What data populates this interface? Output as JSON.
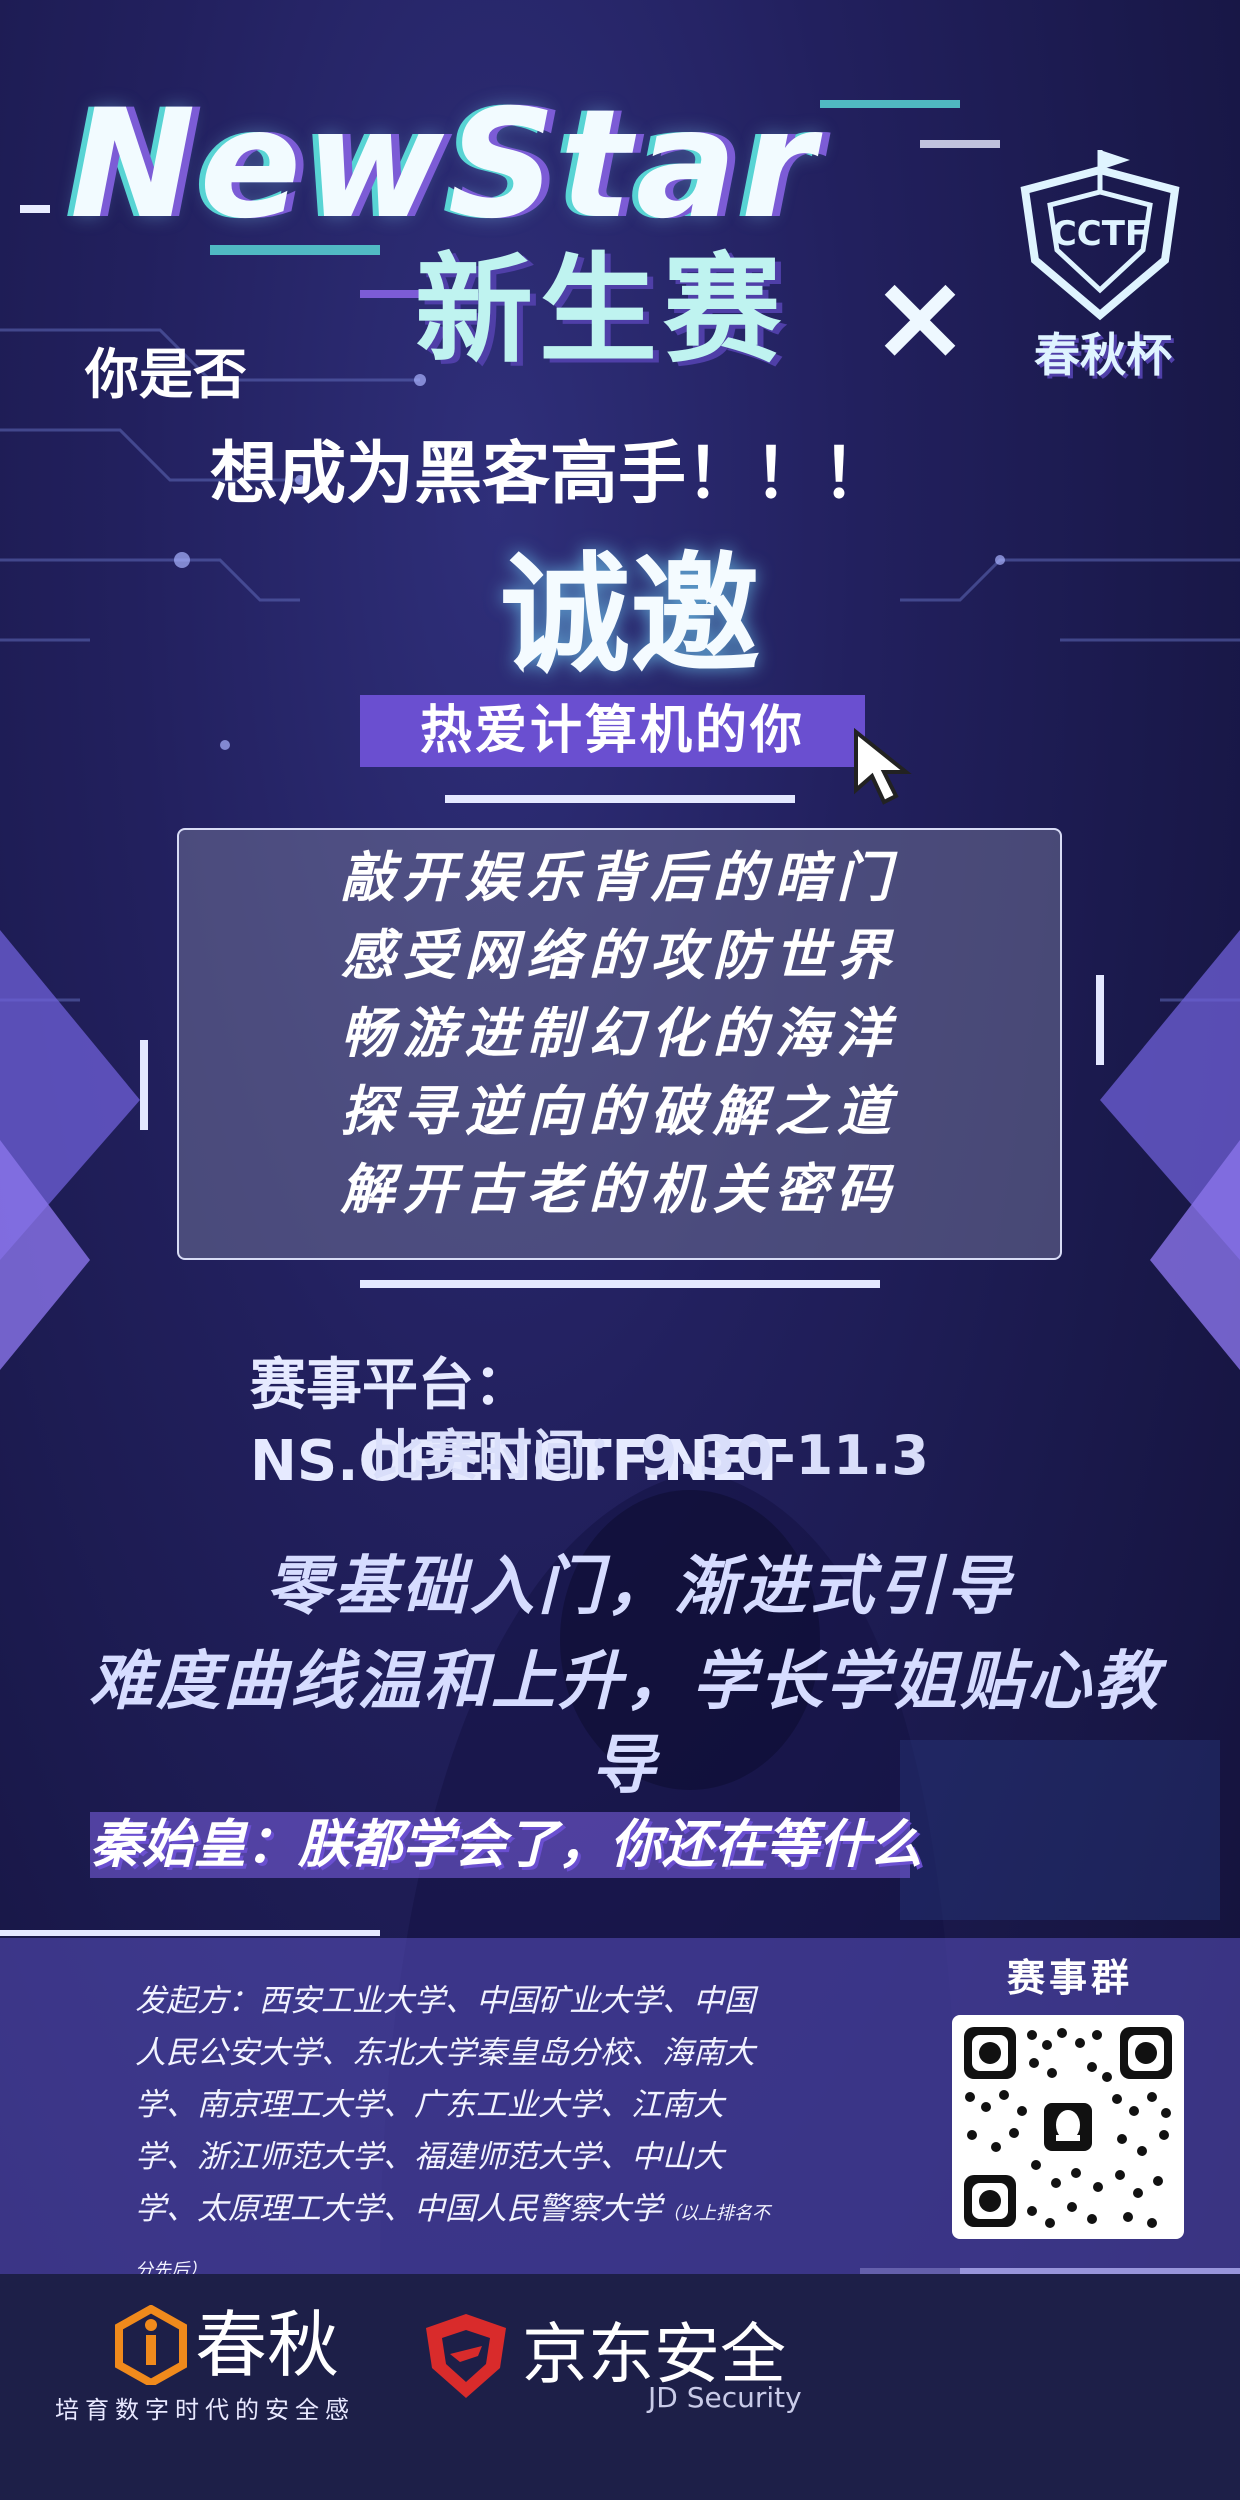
{
  "header": {
    "title": "NewStar",
    "subtitle": "新生赛",
    "times_symbol": "×",
    "partner_badge": "CCTF",
    "partner_label": "春秋杯"
  },
  "hero": {
    "question_line1": "你是否",
    "question_line2": "想成为黑客高手！！！",
    "invite": "诚邀",
    "invite_target": "热爱计算机的你"
  },
  "features": [
    "敲开娱乐背后的暗门",
    "感受网络的攻防世界",
    "畅游进制幻化的海洋",
    "探寻逆向的破解之道",
    "解开古老的机关密码"
  ],
  "event_info": {
    "platform": "赛事平台：NS.OPENCTF.NET",
    "time": "比赛时间：9.30-11.3"
  },
  "slogans": {
    "line1": "零基础入门，渐进式引导",
    "line2": "难度曲线温和上升，学长学姐贴心教导"
  },
  "quote": "秦始皇：朕都学会了，你还在等什么",
  "sponsors": {
    "text": "发起方：西安工业大学、中国矿业大学、中国人民公安大学、东北大学秦皇岛分校、海南大学、南京理工大学、广东工业大学、江南大学、浙江师范大学、福建师范大学、中山大学、太原理工大学、中国人民警察大学",
    "note": "（以上排名不分先后）"
  },
  "group": {
    "title": "赛事群"
  },
  "footer": {
    "chunqiu_name": "春秋",
    "chunqiu_tagline": "培育数字时代的安全感",
    "jd_name": "京东安全",
    "jd_sub": "JD Security"
  },
  "colors": {
    "background": "#22205e",
    "accent_purple": "#6a4fd0",
    "accent_cyan": "#58d4d4",
    "chunqiu_orange": "#f08a1c",
    "jd_red": "#d92b2b"
  }
}
